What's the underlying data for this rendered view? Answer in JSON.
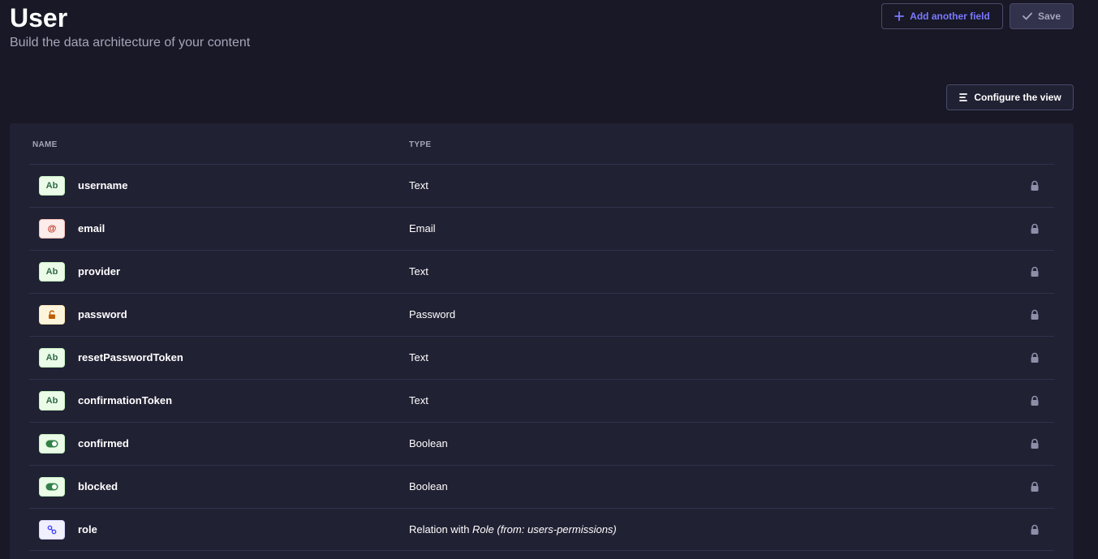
{
  "header": {
    "title": "User",
    "subtitle": "Build the data architecture of your content"
  },
  "actions": {
    "add_field_label": "Add another field",
    "save_label": "Save",
    "configure_view_label": "Configure the view"
  },
  "table": {
    "columns": {
      "name": "NAME",
      "type": "TYPE"
    },
    "rows": [
      {
        "badge": "Ab",
        "icon": "text-type-icon",
        "name": "username",
        "type": "Text"
      },
      {
        "badge": "@",
        "icon": "email-type-icon",
        "name": "email",
        "type": "Email"
      },
      {
        "badge": "Ab",
        "icon": "text-type-icon",
        "name": "provider",
        "type": "Text"
      },
      {
        "badge": "",
        "icon": "password-type-icon",
        "name": "password",
        "type": "Password"
      },
      {
        "badge": "Ab",
        "icon": "text-type-icon",
        "name": "resetPasswordToken",
        "type": "Text"
      },
      {
        "badge": "Ab",
        "icon": "text-type-icon",
        "name": "confirmationToken",
        "type": "Text"
      },
      {
        "badge": "",
        "icon": "boolean-type-icon",
        "name": "confirmed",
        "type": "Boolean"
      },
      {
        "badge": "",
        "icon": "boolean-type-icon",
        "name": "blocked",
        "type": "Boolean"
      },
      {
        "badge": "",
        "icon": "relation-type-icon",
        "name": "role",
        "type_prefix": "Relation with ",
        "type_target": "Role",
        "type_suffix": " (from: users-permissions)"
      }
    ]
  },
  "colors": {
    "background": "#181826",
    "panel": "#212134",
    "accent": "#7b79ff",
    "text_muted": "#a5a5ba",
    "border": "#32324d"
  }
}
